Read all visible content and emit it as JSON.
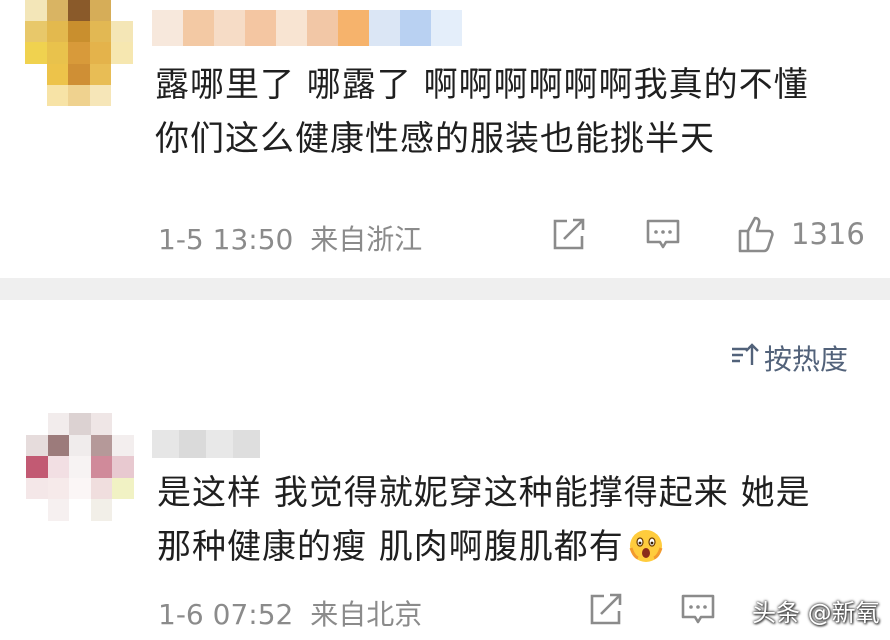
{
  "comments": [
    {
      "text_line1": "露哪里了 哪露了 啊啊啊啊啊啊我真的不懂",
      "text_line2": "你们这么健康性感的服装也能挑半天",
      "time": "1-5 13:50",
      "location": "来自浙江",
      "likes": "1316"
    },
    {
      "text_line1": "是这样 我觉得就妮穿这种能撑得起来 她是",
      "text_line2": "那种健康的瘦 肌肉啊腹肌都有",
      "emoji": "scared-face-emoji",
      "time": "1-6 07:52",
      "location": "来自北京"
    }
  ],
  "sort": {
    "label": "按热度",
    "icon": "sort-icon"
  },
  "watermark": "头条 @新氧",
  "colors": {
    "divider": "#efefef",
    "meta_text": "#8b8b8b",
    "sort_text": "#52627a"
  }
}
